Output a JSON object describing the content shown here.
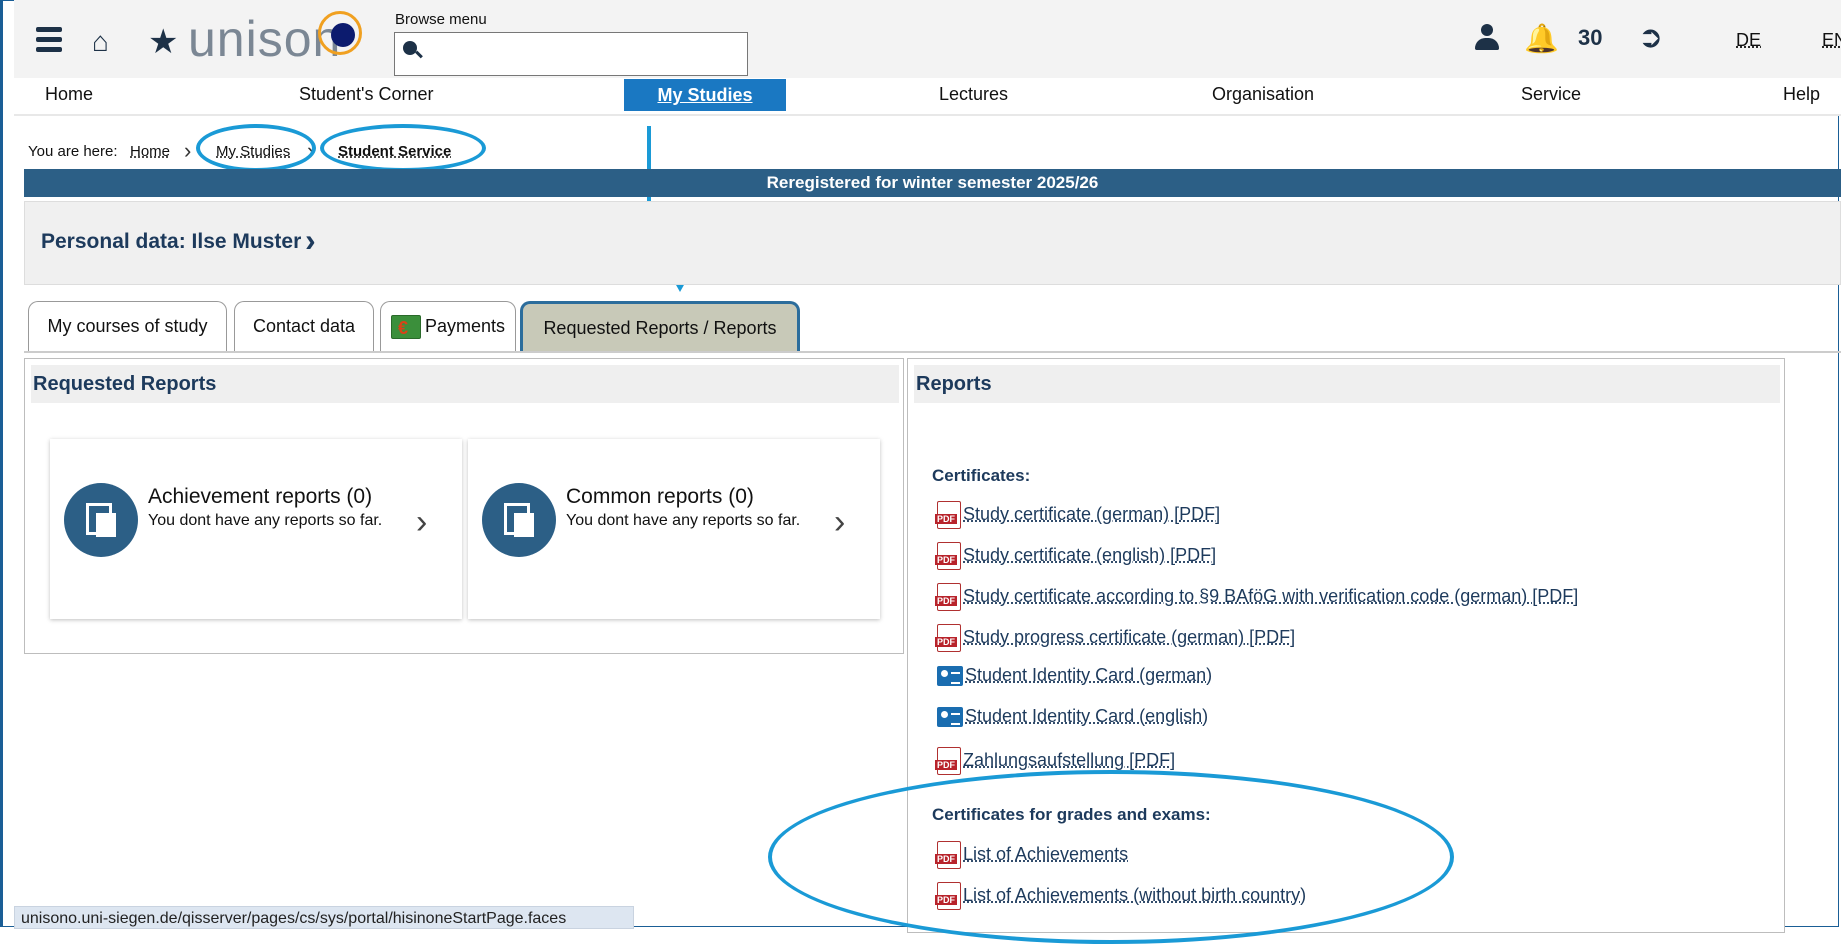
{
  "header": {
    "logo_text": "unison",
    "browse_label": "Browse menu",
    "search_placeholder": "",
    "notifications_count": "30",
    "lang_de": "DE",
    "lang_en": "EN"
  },
  "nav": {
    "items": [
      "Home",
      "Student's Corner",
      "My Studies",
      "Lectures",
      "Organisation",
      "Service",
      "Help"
    ]
  },
  "breadcrumb": {
    "label": "You are here:",
    "items": [
      "Home",
      "My Studies"
    ],
    "current": "Student Service"
  },
  "banner": "Reregistered for winter semester 2025/26",
  "personal": {
    "label": "Personal data: Ilse Muster"
  },
  "tabs": [
    "My courses of study",
    "Contact data",
    "Payments",
    "Requested Reports / Reports"
  ],
  "requested_reports": {
    "title": "Requested Reports",
    "cards": [
      {
        "title": "Achievement reports (0)",
        "subtitle": "You dont have any reports so far."
      },
      {
        "title": "Common reports (0)",
        "subtitle": "You dont have any reports so far."
      }
    ]
  },
  "reports": {
    "title": "Reports",
    "certificates_label": "Certificates:",
    "certificates": [
      {
        "icon": "pdf-icon",
        "label": "Study certificate (german) [PDF]"
      },
      {
        "icon": "pdf-icon",
        "label": "Study certificate (english) [PDF]"
      },
      {
        "icon": "pdf-icon",
        "label": "Study certificate according to §9 BAföG with verification code (german) [PDF]"
      },
      {
        "icon": "pdf-icon",
        "label": "Study progress certificate (german) [PDF]"
      },
      {
        "icon": "id-card-icon",
        "label": "Student Identity Card (german)"
      },
      {
        "icon": "id-card-icon",
        "label": "Student Identity Card (english)"
      },
      {
        "icon": "pdf-icon",
        "label": "Zahlungsaufstellung [PDF]"
      }
    ],
    "grades_label": "Certificates for grades and exams:",
    "grades": [
      {
        "icon": "pdf-icon",
        "label": "List of Achievements"
      },
      {
        "icon": "pdf-icon",
        "label": "List of Achievements (without birth country)"
      }
    ]
  },
  "statusbar": "unisono.uni-siegen.de/qisserver/pages/cs/sys/portal/hisinoneStartPage.faces",
  "colors": {
    "primary": "#2c5f86",
    "nav_active": "#1a78c2",
    "annotation": "#1a9ad6"
  }
}
